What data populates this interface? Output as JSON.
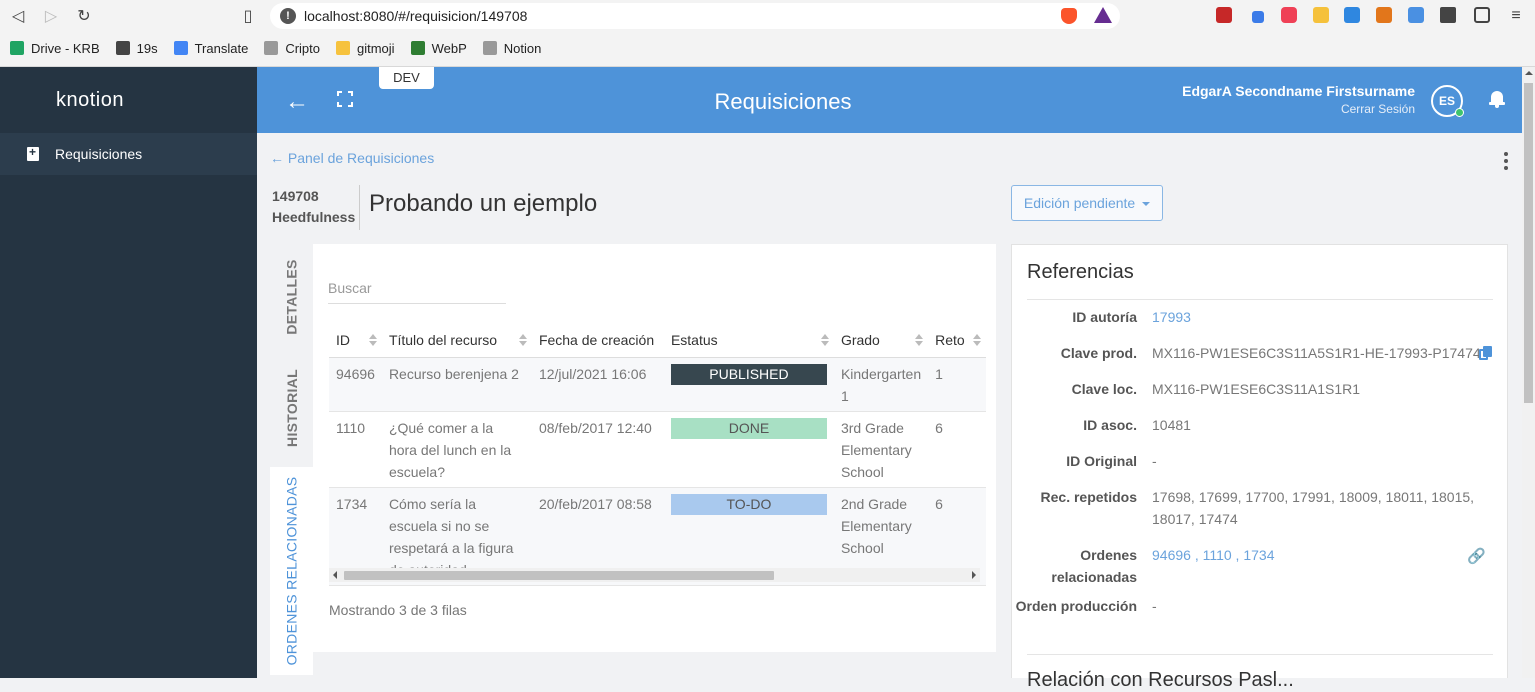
{
  "browser": {
    "url": "localhost:8080/#/requisicion/149708",
    "bookmarks": [
      "Drive - KRB",
      "19s",
      "Translate",
      "Cripto",
      "gitmoji",
      "WebP",
      "Notion"
    ]
  },
  "sidebar": {
    "logo": "knotion",
    "items": [
      {
        "label": "Requisiciones"
      }
    ]
  },
  "header": {
    "title": "Requisiciones",
    "env_badge": "DEV",
    "user_name": "EdgarA Secondname Firstsurname",
    "logout": "Cerrar Sesión",
    "avatar_initials": "ES"
  },
  "page": {
    "breadcrumb": "← Panel de Requisiciones",
    "req_id": "149708",
    "req_owner": "Heedfulness",
    "req_title": "Probando un ejemplo",
    "status_button": "Edición pendiente"
  },
  "tabs": [
    {
      "label": "DETALLES"
    },
    {
      "label": "HISTORIAL"
    },
    {
      "label": "ORDENES RELACIONADAS"
    }
  ],
  "table": {
    "search_placeholder": "Buscar",
    "columns": [
      "ID",
      "Título del recurso",
      "Fecha de creación",
      "Estatus",
      "Grado",
      "Reto"
    ],
    "rows": [
      {
        "id": "94696",
        "title": "Recurso berenjena 2",
        "date": "12/jul/2021 16:06",
        "status": "PUBLISHED",
        "grade": "Kindergarten 1",
        "reto": "1"
      },
      {
        "id": "1110",
        "title": "¿Qué comer a la hora del lunch en la escuela?",
        "date": "08/feb/2017 12:40",
        "status": "DONE",
        "grade": "3rd Grade Elementary School",
        "reto": "6"
      },
      {
        "id": "1734",
        "title": "Cómo sería la escuela si no se respetará a la figura de autoridad",
        "date": "20/feb/2017 08:58",
        "status": "TO-DO",
        "grade": "2nd Grade Elementary School",
        "reto": "6"
      }
    ],
    "footer": "Mostrando 3 de 3 filas"
  },
  "status_colors": {
    "PUBLISHED": {
      "bg": "#37474f",
      "fg": "#ffffff"
    },
    "DONE": {
      "bg": "#a8e0c4",
      "fg": "#555555"
    },
    "TO-DO": {
      "bg": "#a9c9ee",
      "fg": "#555555"
    }
  },
  "references": {
    "title": "Referencias",
    "id_autoria_label": "ID autoría",
    "id_autoria": "17993",
    "clave_prod_label": "Clave prod.",
    "clave_prod": "MX116-PW1ESE6C3S11A5S1R1-HE-17993-P17474",
    "clave_loc_label": "Clave loc.",
    "clave_loc": "MX116-PW1ESE6C3S11A1S1R1",
    "id_asoc_label": "ID asoc.",
    "id_asoc": "10481",
    "id_original_label": "ID Original",
    "id_original": "-",
    "rec_repetidos_label": "Rec. repetidos",
    "rec_repetidos": "17698, 17699, 17700, 17991, 18009, 18011, 18015, 18017, 17474",
    "ordenes_label": "Ordenes relacionadas",
    "ordenes": "94696 ,  1110 ,  1734",
    "orden_prod_label": "Orden producción",
    "orden_prod": "-",
    "next_section": "Relación con Recursos Pasl..."
  },
  "accent": "#4e93d9"
}
